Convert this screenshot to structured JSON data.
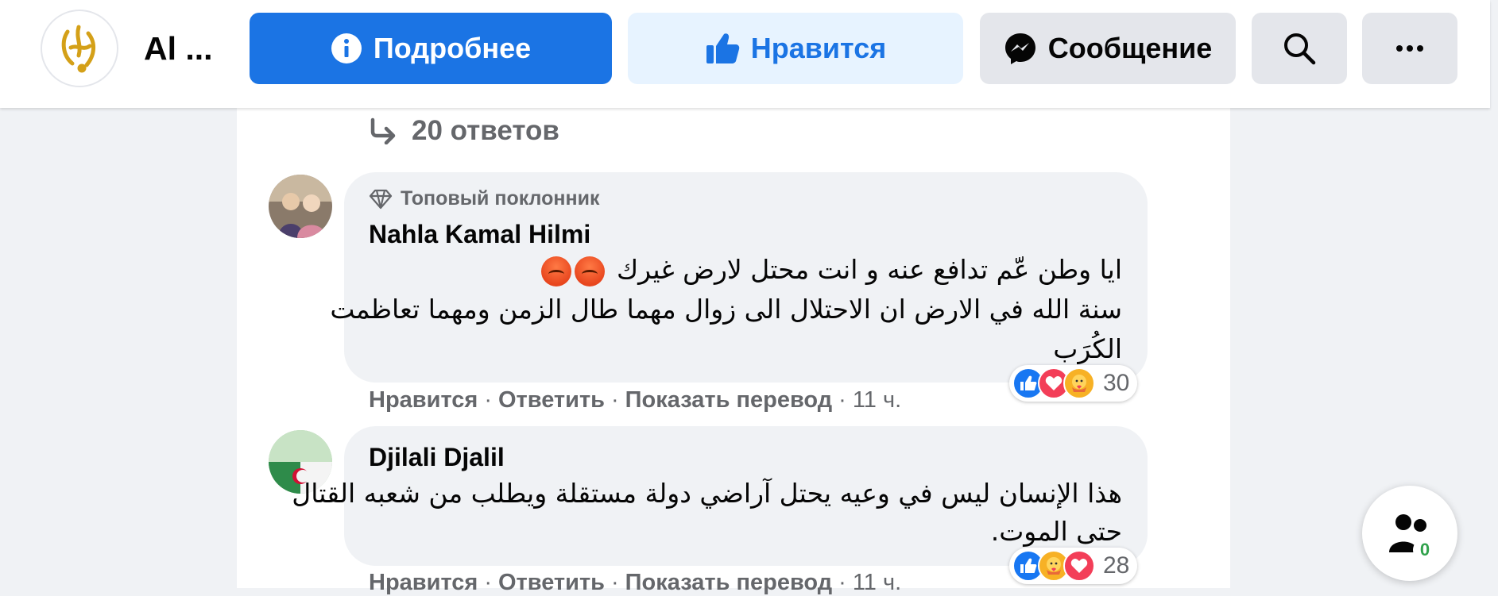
{
  "header": {
    "page_name": "Al ...",
    "details_label": "Подробнее",
    "like_label": "Нравится",
    "message_label": "Сообщение",
    "more_label": "···"
  },
  "thread": {
    "replies_label": "20 ответов"
  },
  "comments": [
    {
      "badge": "Топовый поклонник",
      "author": "Nahla Kamal Hilmi",
      "lines": [
        "ايا وطن عّم تدافع عنه و انت محتل لارض غيرك",
        "سنة الله في الارض ان الاحتلال الى زوال مهما طال الزمن ومهما تعاظمت",
        "الكُرَب"
      ],
      "reactions": [
        "like",
        "love",
        "care"
      ],
      "reaction_count": "30",
      "actions": {
        "like": "Нравится",
        "reply": "Ответить",
        "translate": "Показать перевод",
        "sep": "·",
        "time": "11 ч."
      }
    },
    {
      "author": "Djilali Djalil",
      "lines": [
        "هذا الإنسان ليس في وعيه يحتل آراضي دولة مستقلة ويطلب من شعبه القتال",
        "حتى الموت."
      ],
      "reactions": [
        "like",
        "care",
        "love"
      ],
      "reaction_count": "28",
      "actions": {
        "like": "Нравится",
        "reply": "Ответить",
        "translate": "Показать перевод",
        "sep": "·",
        "time": "11 ч."
      }
    }
  ],
  "fab": {
    "count": "0"
  },
  "colors": {
    "primary": "#1b74e4",
    "like_bg": "#e7f3ff",
    "secondary_btn": "#e4e6eb",
    "bubble": "#f0f2f5",
    "meta": "#65676b"
  }
}
